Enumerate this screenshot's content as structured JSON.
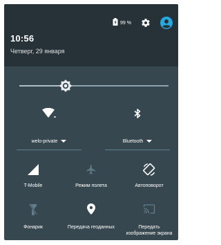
{
  "status": {
    "battery_percent": "99 %",
    "time": "10:56",
    "date": "Четверг, 29 января"
  },
  "brightness": {
    "level": 0.31
  },
  "wifi": {
    "network": "welo-private"
  },
  "bluetooth": {
    "label": "Bluetooth"
  },
  "tiles": {
    "mobile": "T-Mobile",
    "airplane": "Режим полета",
    "autorotate": "Автоповорот",
    "flashlight": "Фонарик",
    "location": "Передача геоданных",
    "cast_line1": "Передать",
    "cast_line2": "изображение экрана"
  },
  "colors": {
    "header_bg": "#263238",
    "panel_bg": "#37474f",
    "accent": "#26a9e0",
    "dim_icon": "#607d8b"
  },
  "icons": {
    "battery": "battery-icon",
    "settings": "gear-icon",
    "account": "account-circle-icon",
    "wifi": "wifi-icon",
    "bluetooth": "bluetooth-icon",
    "signal": "signal-icon",
    "airplane": "airplane-icon",
    "rotate": "screen-rotation-icon",
    "flashlight": "flashlight-icon",
    "location": "location-icon",
    "cast": "cast-icon"
  }
}
